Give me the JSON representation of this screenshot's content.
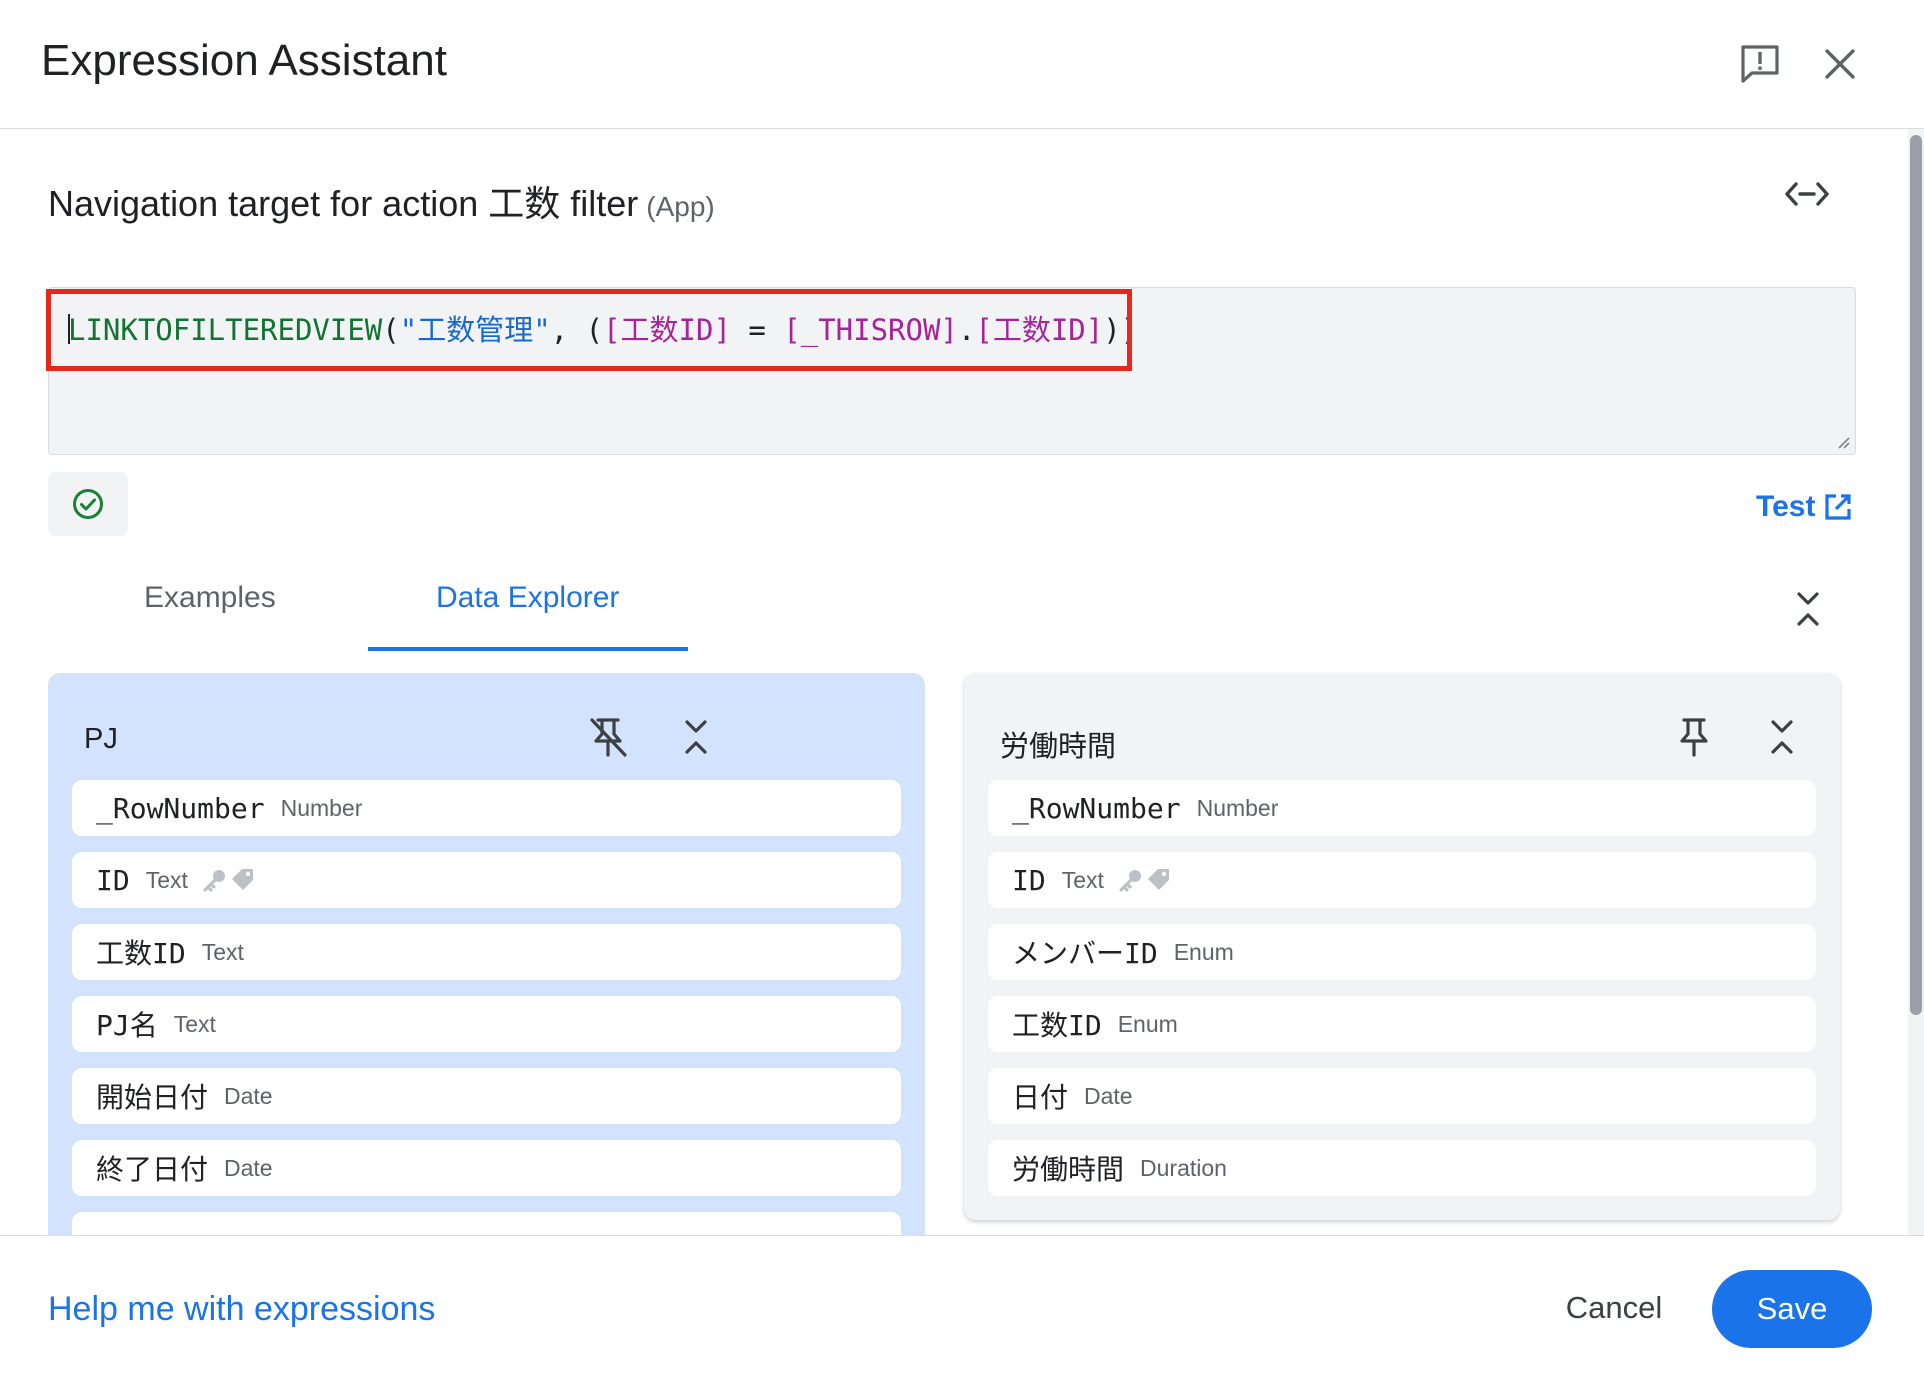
{
  "dialog": {
    "title": "Expression Assistant"
  },
  "header_icons": {
    "feedback": "feedback-icon",
    "close": "close-icon"
  },
  "context": {
    "label": "Navigation target for action 工数 filter",
    "suffix": "(App)"
  },
  "expression": {
    "fn": "LINKTOFILTEREDVIEW",
    "open": "(",
    "table_arg": "\"工数管理\"",
    "comma_paren": ", (",
    "col_left": "[工数ID]",
    "op": " = ",
    "thisrow": "[_THISROW]",
    "dot": ".",
    "col_right": "[工数ID]",
    "close": "))"
  },
  "validation": {
    "status": "valid",
    "icon": "check-circle-icon"
  },
  "test_link": {
    "label": "Test"
  },
  "tabs": [
    {
      "label": "Examples",
      "active": false
    },
    {
      "label": "Data Explorer",
      "active": true
    }
  ],
  "panels": [
    {
      "title": "PJ",
      "pinned": true,
      "fields": [
        {
          "name": "_RowNumber",
          "type": "Number"
        },
        {
          "name": "ID",
          "type": "Text",
          "key": true
        },
        {
          "name": "工数ID",
          "type": "Text"
        },
        {
          "name": "PJ名",
          "type": "Text"
        },
        {
          "name": "開始日付",
          "type": "Date"
        },
        {
          "name": "終了日付",
          "type": "Date"
        }
      ]
    },
    {
      "title": "労働時間",
      "pinned": false,
      "fields": [
        {
          "name": "_RowNumber",
          "type": "Number"
        },
        {
          "name": "ID",
          "type": "Text",
          "key": true
        },
        {
          "name": "メンバーID",
          "type": "Enum"
        },
        {
          "name": "工数ID",
          "type": "Enum"
        },
        {
          "name": "日付",
          "type": "Date"
        },
        {
          "name": "労働時間",
          "type": "Duration"
        }
      ]
    }
  ],
  "footer": {
    "help": "Help me with expressions",
    "cancel": "Cancel",
    "save": "Save"
  },
  "colors": {
    "accent": "#1a73e8",
    "highlight": "#e8271c",
    "function": "#137333",
    "string": "#1967d2",
    "column": "#a8239a",
    "success": "#188038",
    "panel_active": "#d3e3fd"
  }
}
